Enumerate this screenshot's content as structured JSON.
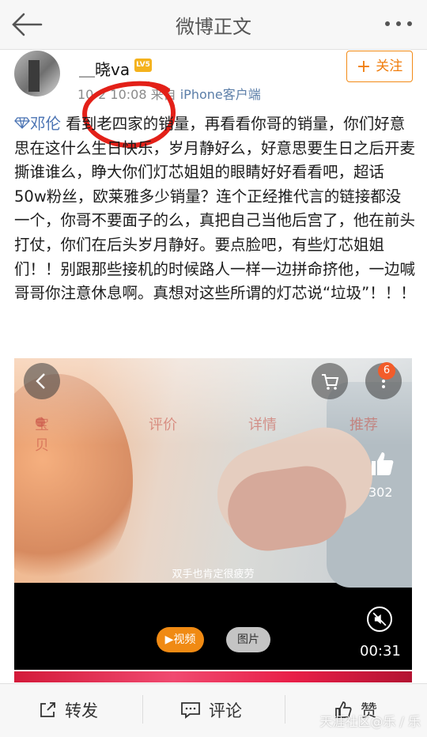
{
  "nav": {
    "title": "微博正文"
  },
  "author": {
    "name": "＿晓va",
    "level_badge": "LV5",
    "time": "10-2 10:08",
    "source_prefix": "来自",
    "source": "iPhone客户端",
    "follow_label": "关注"
  },
  "post": {
    "tag": "邓伦",
    "text": " 看到老四家的销量，再看看你哥的销量，你们好意思在这什么生日快乐，岁月静好么，好意思要生日之后开麦撕谁谁么，睁大你们灯芯姐姐的眼睛好好看看吧，超话50w粉丝，欧莱雅多少销量？连个正经推代言的链接都没一个，你哥不要面子的么，真把自己当他后宫了，他在前头打仗，你们在后头岁月静好。要点脸吧，有些灯芯姐姐们！！别跟那些接机的时候路人一样一边拼命挤他，一边喊哥哥你注意休息啊。真想对这些所谓的灯芯说“垃圾”！！！"
  },
  "media": {
    "cart_badge": "6",
    "tabs": [
      "宝贝",
      "评价",
      "详情",
      "推荐"
    ],
    "like_count": "302",
    "caption": "双手也肯定很疲劳",
    "video_label": "视频",
    "picture_label": "图片",
    "duration": "00:31"
  },
  "bottom": {
    "repost": "转发",
    "comment": "评论",
    "like": "赞",
    "watermark": "天涯社区@乐 / 乐"
  },
  "colors": {
    "accent": "#f28a16",
    "link": "#4a73b3",
    "badge": "#f4b21d"
  }
}
